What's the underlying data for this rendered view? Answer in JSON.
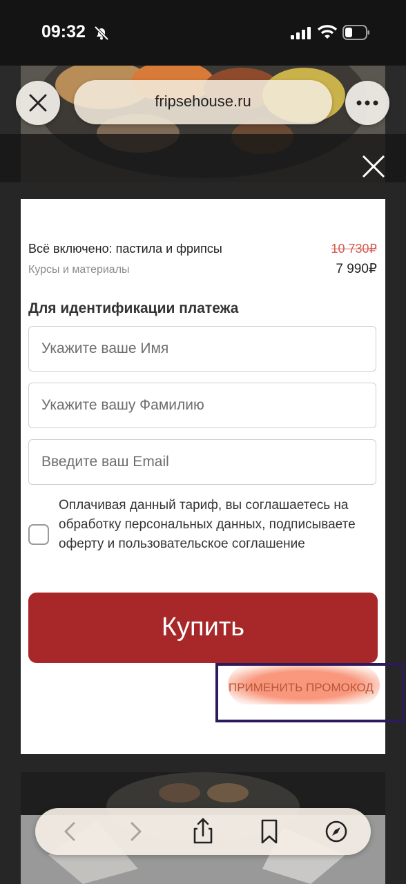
{
  "status_bar": {
    "time": "09:32"
  },
  "browser": {
    "url": "fripsehouse.ru"
  },
  "product": {
    "name": "Всё включено: пастила и фрипсы",
    "subtitle": "Курсы и материалы",
    "old_price": "10 730₽",
    "new_price": "7 990₽"
  },
  "form": {
    "title": "Для идентификации платежа",
    "first_name_placeholder": "Укажите ваше Имя",
    "last_name_placeholder": "Укажите вашу Фамилию",
    "email_placeholder": "Введите ваш Email",
    "consent_text": "Оплачивая данный тариф, вы соглашаетесь на обработку персональных данных, подписываете оферту и пользовательское соглашение",
    "buy_label": "Купить",
    "promo_label": "ПРИМЕНИТЬ ПРОМОКОД"
  },
  "colors": {
    "buy_button": "#a8282a",
    "old_price": "#d35a4f",
    "promo_text": "#b5573c",
    "annotation_border": "#2c1a5a"
  },
  "icons": [
    "bell-off-icon",
    "signal-icon",
    "wifi-icon",
    "battery-icon",
    "close-icon",
    "more-icon",
    "back-icon",
    "forward-icon",
    "share-icon",
    "bookmarks-icon",
    "compass-icon"
  ]
}
